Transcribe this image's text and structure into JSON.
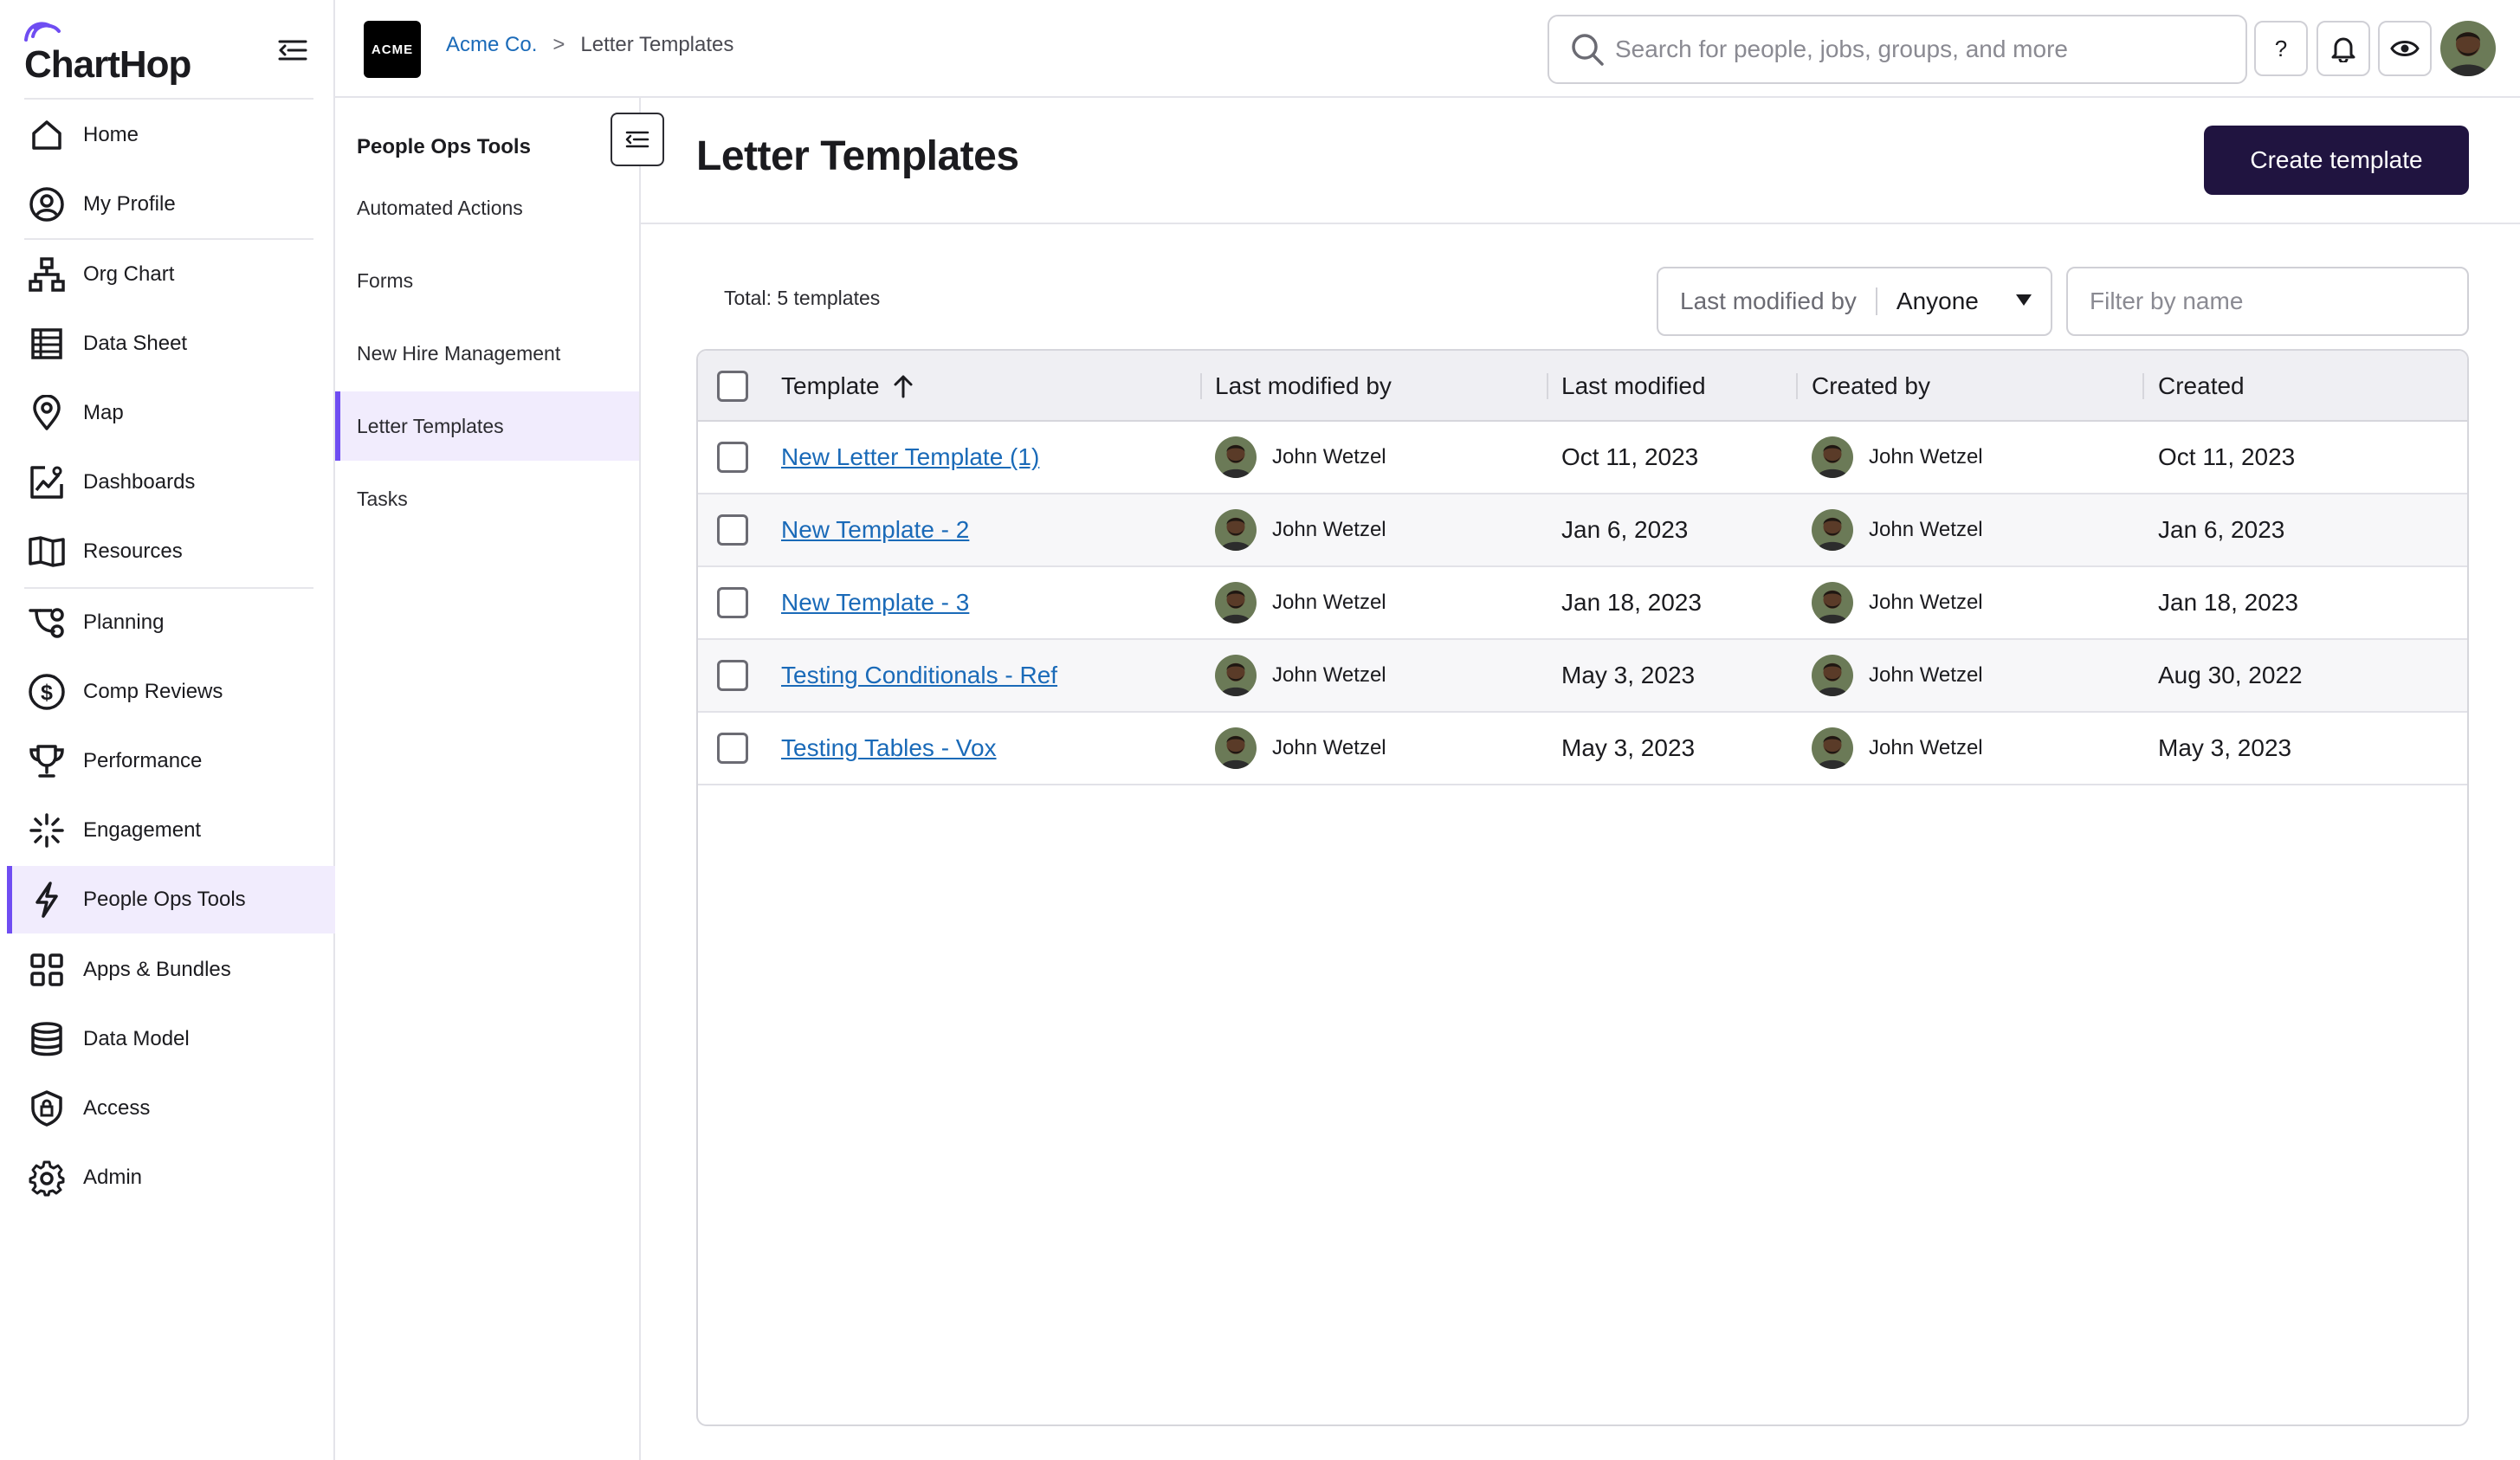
{
  "brand": {
    "name": "ChartHop"
  },
  "colors": {
    "accent": "#6f4df2",
    "link": "#1a6ab8",
    "primary_button": "#201440",
    "active_bg": "#f1ecfd"
  },
  "nav": {
    "items": [
      {
        "label": "Home",
        "icon": "home-icon"
      },
      {
        "label": "My Profile",
        "icon": "user-circle-icon"
      },
      {
        "label": "Org Chart",
        "icon": "org-chart-icon"
      },
      {
        "label": "Data Sheet",
        "icon": "table-icon"
      },
      {
        "label": "Map",
        "icon": "map-pin-icon"
      },
      {
        "label": "Dashboards",
        "icon": "dashboard-icon"
      },
      {
        "label": "Resources",
        "icon": "book-icon"
      },
      {
        "label": "Planning",
        "icon": "planning-icon"
      },
      {
        "label": "Comp Reviews",
        "icon": "dollar-circle-icon"
      },
      {
        "label": "Performance",
        "icon": "trophy-icon"
      },
      {
        "label": "Engagement",
        "icon": "sparkle-icon"
      },
      {
        "label": "People Ops Tools",
        "icon": "lightning-icon",
        "active": true
      },
      {
        "label": "Apps & Bundles",
        "icon": "apps-grid-icon"
      },
      {
        "label": "Data Model",
        "icon": "database-icon"
      },
      {
        "label": "Access",
        "icon": "shield-lock-icon"
      },
      {
        "label": "Admin",
        "icon": "gear-icon"
      }
    ]
  },
  "subnav": {
    "title": "People Ops Tools",
    "items": [
      {
        "label": "Automated Actions"
      },
      {
        "label": "Forms"
      },
      {
        "label": "New Hire Management"
      },
      {
        "label": "Letter Templates",
        "active": true
      },
      {
        "label": "Tasks"
      }
    ]
  },
  "topbar": {
    "org_logo": "ACME",
    "breadcrumb": {
      "org": "Acme Co.",
      "sep": ">",
      "current": "Letter Templates"
    },
    "search_placeholder": "Search for people, jobs, groups, and more",
    "help_label": "?"
  },
  "main": {
    "title": "Letter Templates",
    "create_label": "Create template",
    "total": "Total: 5 templates",
    "filter": {
      "label": "Last modified by",
      "value": "Anyone",
      "name_placeholder": "Filter by name"
    },
    "columns": [
      "Template",
      "Last modified by",
      "Last modified",
      "Created by",
      "Created"
    ],
    "sort": {
      "column": "Template",
      "direction": "ascending"
    },
    "rows": [
      {
        "template": "New Letter Template (1)",
        "modified_by": "John Wetzel",
        "modified": "Oct 11, 2023",
        "created_by": "John Wetzel",
        "created": "Oct 11, 2023"
      },
      {
        "template": "New Template - 2",
        "modified_by": "John Wetzel",
        "modified": "Jan 6, 2023",
        "created_by": "John Wetzel",
        "created": "Jan 6, 2023"
      },
      {
        "template": "New Template - 3",
        "modified_by": "John Wetzel",
        "modified": "Jan 18, 2023",
        "created_by": "John Wetzel",
        "created": "Jan 18, 2023"
      },
      {
        "template": "Testing Conditionals - Ref",
        "modified_by": "John Wetzel",
        "modified": "May 3, 2023",
        "created_by": "John Wetzel",
        "created": "Aug 30, 2022"
      },
      {
        "template": "Testing Tables - Vox",
        "modified_by": "John Wetzel",
        "modified": "May 3, 2023",
        "created_by": "John Wetzel",
        "created": "May 3, 2023"
      }
    ]
  }
}
